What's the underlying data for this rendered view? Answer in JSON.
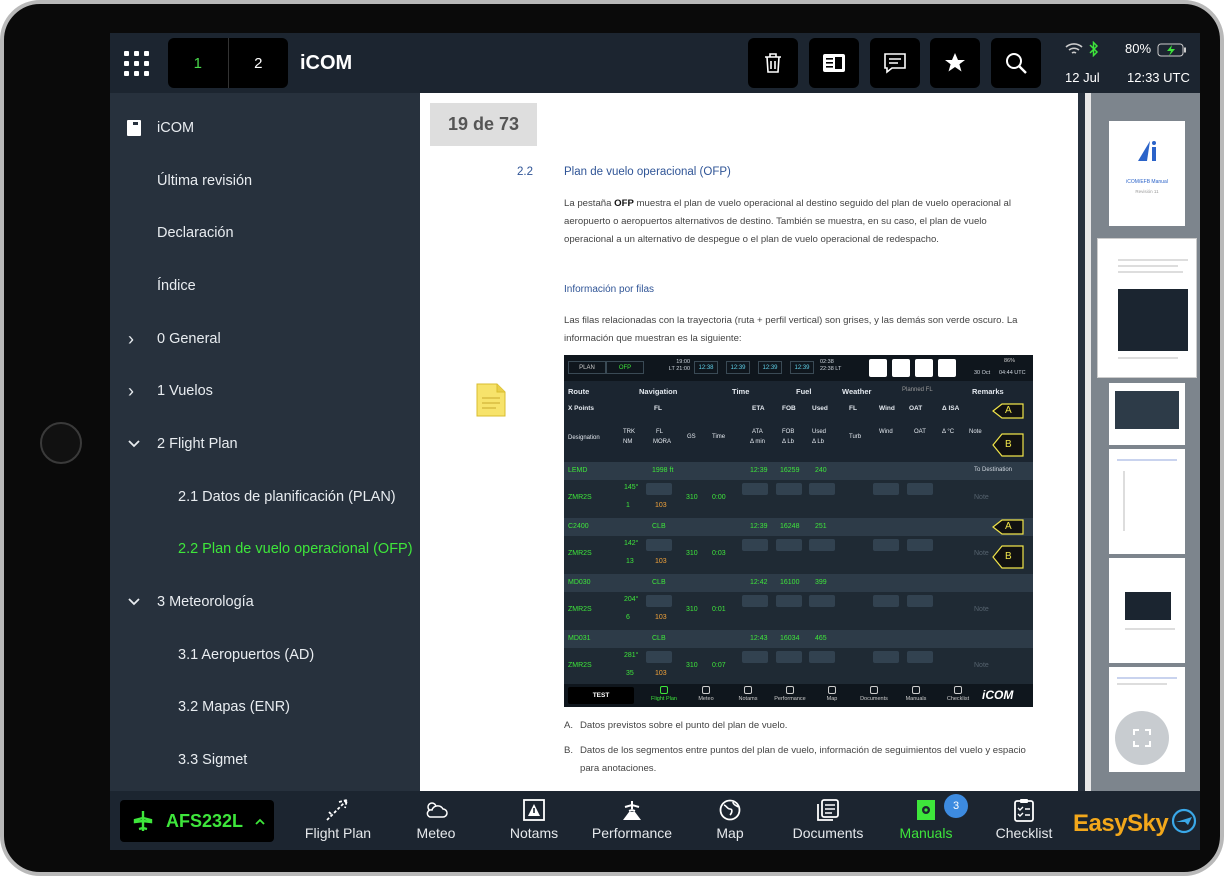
{
  "app": {
    "title": "iCOM"
  },
  "tabs": [
    {
      "label": "1",
      "active": true
    },
    {
      "label": "2",
      "active": false
    }
  ],
  "toolbar": {
    "icons": [
      "trash-icon",
      "reader-icon",
      "comment-icon",
      "star-icon",
      "search-icon"
    ]
  },
  "status": {
    "battery": "80%",
    "date": "12 Jul",
    "time": "12:33 UTC"
  },
  "sidebar": {
    "items": [
      {
        "label": "iCOM",
        "level": 0,
        "chevron": "",
        "icon": "book-icon"
      },
      {
        "label": "Última revisión",
        "level": 0,
        "chevron": ""
      },
      {
        "label": "Declaración",
        "level": 0,
        "chevron": ""
      },
      {
        "label": "Índice",
        "level": 0,
        "chevron": ""
      },
      {
        "label": "0 General",
        "level": 0,
        "chevron": "›"
      },
      {
        "label": "1 Vuelos",
        "level": 0,
        "chevron": "›"
      },
      {
        "label": "2 Flight Plan",
        "level": 0,
        "chevron": "⌄"
      },
      {
        "label": "2.1 Datos de planificación (PLAN)",
        "level": 1,
        "chevron": ""
      },
      {
        "label": "2.2 Plan de vuelo operacional (OFP)",
        "level": 1,
        "chevron": "",
        "active": true
      },
      {
        "label": "3 Meteorología",
        "level": 0,
        "chevron": "⌄"
      },
      {
        "label": "3.1 Aeropuertos (AD)",
        "level": 1,
        "chevron": ""
      },
      {
        "label": "3.2 Mapas (ENR)",
        "level": 1,
        "chevron": ""
      },
      {
        "label": "3.3 Sigmet",
        "level": 1,
        "chevron": ""
      }
    ]
  },
  "document": {
    "page_indicator": "19 de 73",
    "section_number": "2.2",
    "section_title": "Plan de vuelo operacional (OFP)",
    "para1_bold": "OFP",
    "para1_pre": "La pestaña ",
    "para1_post": " muestra el plan de vuelo operacional al destino seguido del plan de vuelo operacional al aeropuerto o aeropuertos alternativos de destino. También se muestra, en su caso, el plan de vuelo operacional a un alternativo de despegue o el plan de vuelo operacional de redespacho.",
    "subheading": "Información por filas",
    "para2": "Las filas relacionadas con la trayectoria (ruta + perfil vertical) son grises, y las demás son verde oscuro. La información que muestran es la siguiente:",
    "list": [
      {
        "marker": "A.",
        "text": "Datos previstos sobre el punto del plan de vuelo."
      },
      {
        "marker": "B.",
        "text": "Datos de los segmentos entre puntos del plan de vuelo, información de seguimientos del vuelo y espacio para anotaciones."
      }
    ]
  },
  "ofp_screenshot": {
    "tabs": [
      "PLAN",
      "OFP"
    ],
    "lt": [
      "19:00",
      "LT 21:00"
    ],
    "times": [
      "12:38",
      "12:39",
      "12:39",
      "12:39"
    ],
    "lt2": [
      "02:38",
      "22:38 LT"
    ],
    "battery": "86%",
    "date": "30 Oct",
    "time": "04:44 UTC",
    "headers": [
      "Route",
      "Navigation",
      "Time",
      "Fuel",
      "Weather",
      "Planned FL",
      "Remarks"
    ],
    "sub1": [
      "X Points",
      "FL",
      "ETA",
      "FOB",
      "Used",
      "FL",
      "Wind",
      "OAT",
      "Δ ISA"
    ],
    "sub2": [
      "Designation",
      "TRK",
      "NM",
      "FL",
      "MORA",
      "GS",
      "Time",
      "ATA",
      "Δ min",
      "FOB",
      "Δ Lb",
      "Used",
      "Δ Lb",
      "Turb",
      "Wind",
      "OAT",
      "Δ °C",
      "Note"
    ],
    "rows": [
      {
        "type": "g",
        "name": "LEMD",
        "fl": "1998 ft",
        "eta": "12:39",
        "fob": "16259",
        "used": "240",
        "remark": "To Destination"
      },
      {
        "type": "d",
        "name": "ZMR2S",
        "trk": "145°",
        "nm": "1",
        "mora": "103",
        "gs": "310",
        "time": "0:00",
        "note": "Note"
      },
      {
        "type": "g",
        "name": "C2400",
        "fl": "CLB",
        "eta": "12:39",
        "fob": "16248",
        "used": "251",
        "remark": ""
      },
      {
        "type": "d",
        "name": "ZMR2S",
        "trk": "142°",
        "nm": "13",
        "mora": "103",
        "gs": "310",
        "time": "0:03",
        "note": "Note"
      },
      {
        "type": "g",
        "name": "MD030",
        "fl": "CLB",
        "eta": "12:42",
        "fob": "16100",
        "used": "399",
        "remark": ""
      },
      {
        "type": "d",
        "name": "ZMR2S",
        "trk": "204°",
        "nm": "6",
        "mora": "103",
        "gs": "310",
        "time": "0:01",
        "note": "Note"
      },
      {
        "type": "g",
        "name": "MD031",
        "fl": "CLB",
        "eta": "12:43",
        "fob": "16034",
        "used": "465",
        "remark": ""
      },
      {
        "type": "d",
        "name": "ZMR2S",
        "trk": "281°",
        "nm": "35",
        "mora": "103",
        "gs": "310",
        "time": "0:07",
        "note": "Note"
      }
    ],
    "callouts": [
      "A",
      "B",
      "A",
      "B"
    ],
    "flight": "TEST",
    "footer_tabs": [
      "Flight Plan",
      "Meteo",
      "Notams",
      "Performance",
      "Map",
      "Documents",
      "Manuals",
      "Checklist"
    ],
    "brand": "iCOM"
  },
  "thumbnails": {
    "first_title": "iCOM/EFB Manual",
    "first_sub": "Revisión 11"
  },
  "bottom": {
    "flight_id": "AFS232L",
    "items": [
      {
        "label": "Flight Plan",
        "icon": "flight-plan-icon"
      },
      {
        "label": "Meteo",
        "icon": "meteo-icon"
      },
      {
        "label": "Notams",
        "icon": "notams-icon"
      },
      {
        "label": "Performance",
        "icon": "performance-icon"
      },
      {
        "label": "Map",
        "icon": "globe-icon"
      },
      {
        "label": "Documents",
        "icon": "documents-icon"
      },
      {
        "label": "Manuals",
        "icon": "manuals-icon",
        "active": true
      },
      {
        "label": "Checklist",
        "icon": "checklist-icon"
      }
    ],
    "manuals_badge": "3",
    "brand": "EasySky"
  },
  "colors": {
    "accent_green": "#3ee63b",
    "bar_bg": "#1c2530",
    "sidebar_bg": "#27313d",
    "brand_orange": "#f3a81b",
    "doc_heading": "#2f5496"
  }
}
